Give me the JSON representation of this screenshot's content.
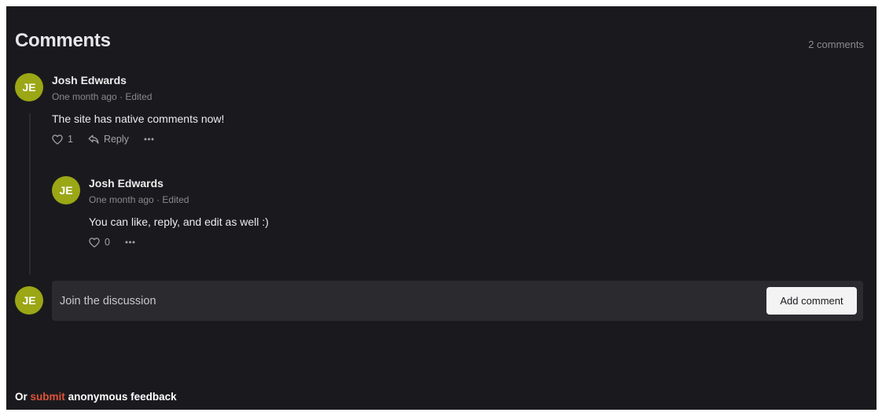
{
  "header": {
    "title": "Comments",
    "count": "2 comments"
  },
  "comments": [
    {
      "avatar": "JE",
      "author": "Josh Edwards",
      "time": "One month ago",
      "separator": "·",
      "edited": "Edited",
      "text": "The site has native comments now!",
      "likes": "1",
      "reply_label": "Reply"
    },
    {
      "avatar": "JE",
      "author": "Josh Edwards",
      "time": "One month ago",
      "separator": "·",
      "edited": "Edited",
      "text": "You can like, reply, and edit as well :)",
      "likes": "0"
    }
  ],
  "composer": {
    "avatar": "JE",
    "placeholder": "Join the discussion",
    "button_label": "Add comment"
  },
  "footer": {
    "prefix": "Or",
    "link": "submit",
    "suffix": "anonymous feedback"
  },
  "colors": {
    "background": "#1a1a1e",
    "avatar": "#9ba715",
    "link": "#e0533a",
    "composer": "#2a2a2f"
  }
}
